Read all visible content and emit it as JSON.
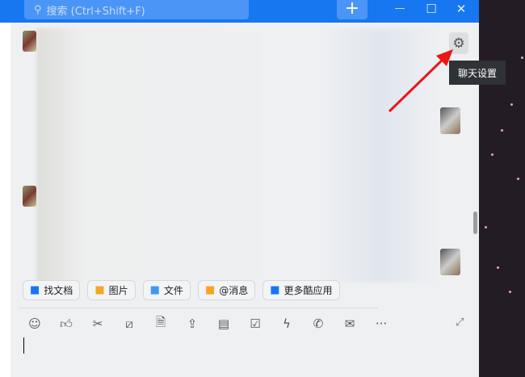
{
  "titlebar": {
    "search_placeholder": "搜索 (Ctrl+Shift+F)",
    "add_label": "+",
    "minimize": "—",
    "maximize": "☐",
    "close": "✕"
  },
  "chat": {
    "settings_tooltip": "聊天设置"
  },
  "quick_actions": [
    {
      "label": "找文档",
      "icon": "doc-search-icon",
      "color": "#1677f0"
    },
    {
      "label": "图片",
      "icon": "image-icon",
      "color": "#f5a623"
    },
    {
      "label": "文件",
      "icon": "folder-icon",
      "color": "#3b9af0"
    },
    {
      "label": "@消息",
      "icon": "at-icon",
      "color": "#f5a623"
    },
    {
      "label": "更多酷应用",
      "icon": "apps-icon",
      "color": "#1677f0"
    }
  ],
  "toolbar": [
    {
      "name": "emoji-icon",
      "glyph": "☺"
    },
    {
      "name": "thumbs-up-icon",
      "glyph": "👍︎"
    },
    {
      "name": "scissors-icon",
      "glyph": "✂"
    },
    {
      "name": "slash-command-icon",
      "glyph": "⧄"
    },
    {
      "name": "new-doc-icon",
      "glyph": "🗎"
    },
    {
      "name": "upload-folder-icon",
      "glyph": "⇪"
    },
    {
      "name": "calendar-icon",
      "glyph": "▤"
    },
    {
      "name": "task-check-icon",
      "glyph": "☑"
    },
    {
      "name": "lightning-icon",
      "glyph": "ϟ"
    },
    {
      "name": "phone-icon",
      "glyph": "✆"
    },
    {
      "name": "mail-icon",
      "glyph": "✉"
    },
    {
      "name": "more-icon",
      "glyph": "···"
    }
  ]
}
